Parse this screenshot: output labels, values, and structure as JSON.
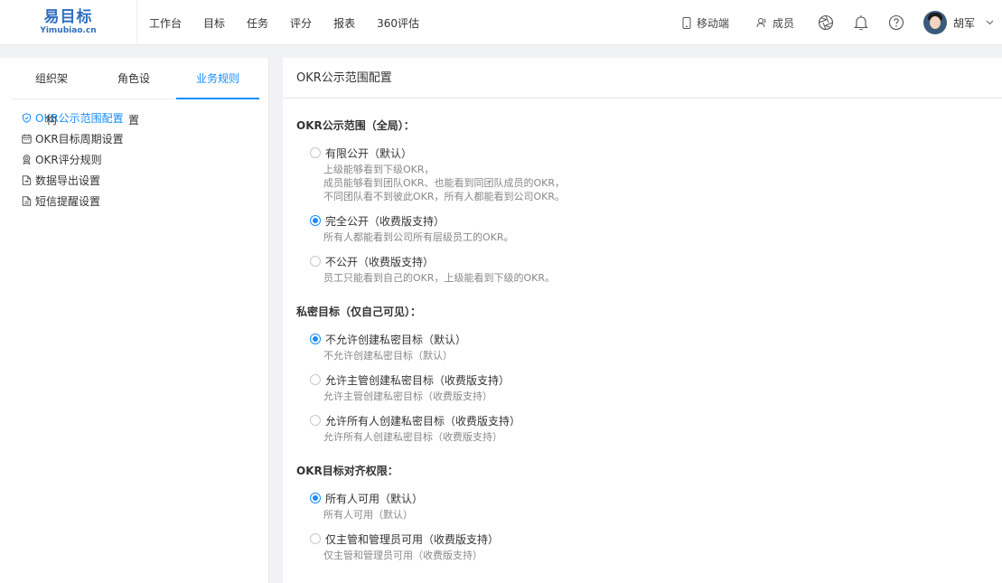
{
  "logo": {
    "cn": "易目标",
    "en": "Yimubiao.cn"
  },
  "nav": [
    "工作台",
    "目标",
    "任务",
    "评分",
    "报表",
    "360评估"
  ],
  "topRight": {
    "mobile": "移动端",
    "members": "成员",
    "user": "胡军"
  },
  "sidebar": {
    "tabs": [
      "组织架构",
      "角色设置",
      "业务规则"
    ],
    "activeTab": 2,
    "items": [
      {
        "label": "OKR公示范围配置",
        "icon": "shield-icon",
        "active": true
      },
      {
        "label": "OKR目标周期设置",
        "icon": "calendar-icon"
      },
      {
        "label": "OKR评分规则",
        "icon": "medal-icon"
      },
      {
        "label": "数据导出设置",
        "icon": "export-icon"
      },
      {
        "label": "短信提醒设置",
        "icon": "document-icon"
      }
    ]
  },
  "main": {
    "header": "OKR公示范围配置",
    "sections": [
      {
        "title": "OKR公示范围（全局）：",
        "options": [
          {
            "label": "有限公开（默认）",
            "checked": false,
            "desc": [
              "上级能够看到下级OKR，",
              "成员能够看到团队OKR、也能看到同团队成员的OKR，",
              "不同团队看不到彼此OKR，所有人都能看到公司OKR。"
            ]
          },
          {
            "label": "完全公开（收费版支持）",
            "checked": true,
            "desc": [
              "所有人都能看到公司所有层级员工的OKR。"
            ]
          },
          {
            "label": "不公开（收费版支持）",
            "checked": false,
            "desc": [
              "员工只能看到自己的OKR，上级能看到下级的OKR。"
            ]
          }
        ]
      },
      {
        "title": "私密目标（仅自己可见）：",
        "options": [
          {
            "label": "不允许创建私密目标（默认）",
            "checked": true,
            "desc": [
              "不允许创建私密目标（默认）"
            ]
          },
          {
            "label": "允许主管创建私密目标（收费版支持）",
            "checked": false,
            "desc": [
              "允许主管创建私密目标（收费版支持）"
            ]
          },
          {
            "label": "允许所有人创建私密目标（收费版支持）",
            "checked": false,
            "desc": [
              "允许所有人创建私密目标（收费版支持）"
            ]
          }
        ]
      },
      {
        "title": "OKR目标对齐权限：",
        "options": [
          {
            "label": "所有人可用（默认）",
            "checked": true,
            "desc": [
              "所有人可用（默认）"
            ]
          },
          {
            "label": "仅主管和管理员可用（收费版支持）",
            "checked": false,
            "desc": [
              "仅主管和管理员可用（收费版支持）"
            ]
          }
        ]
      }
    ]
  },
  "colors": {
    "accent": "#1a8cff",
    "logo": "#2f6ec0",
    "background": "#f0f2f5"
  }
}
